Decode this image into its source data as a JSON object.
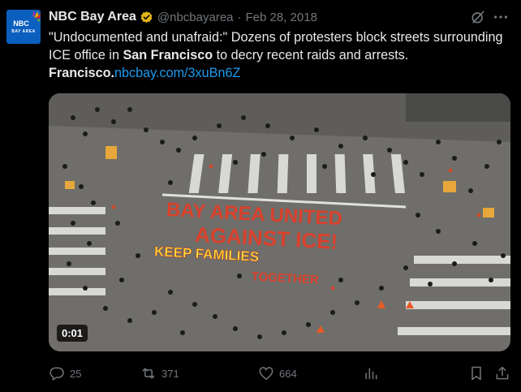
{
  "tweet": {
    "avatar": {
      "logo_text": "NBC",
      "sub_text": "BAY AREA"
    },
    "author_name": "NBC Bay Area",
    "handle": "@nbcbayarea",
    "separator": "·",
    "date": "Feb 28, 2018",
    "text_part1": "\"Undocumented and unafraid:\" Dozens of protesters block streets surrounding ICE office in ",
    "text_bold": "San Francisco",
    "text_part2": " to decry recent raids and arrests.",
    "text_bold2": "Francisco.",
    "link": "nbcbay.com/3xuBn6Z"
  },
  "media": {
    "street_text_line1": "BAY AREA UNITED",
    "street_text_line2": "AGAINST ICE!",
    "street_text_line3": "KEEP FAMILIES",
    "street_text_line4": "TOGETHER",
    "video_duration": "0:01"
  },
  "actions": {
    "replies": "25",
    "reposts": "371",
    "likes": "664"
  },
  "colors": {
    "background": "#000000",
    "text": "#e7e9ea",
    "muted": "#71767b",
    "link": "#1d9bf0",
    "verified_gold": "#e2b719"
  },
  "icons": [
    "verified-badge-icon",
    "grok-icon",
    "more-icon",
    "reply-icon",
    "repost-icon",
    "like-icon",
    "views-icon",
    "bookmark-icon",
    "share-icon"
  ]
}
